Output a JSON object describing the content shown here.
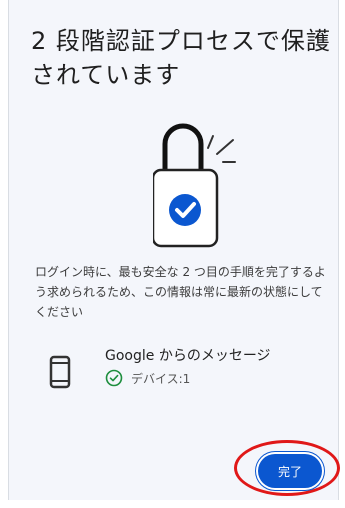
{
  "dialog": {
    "title": "2 段階認証プロセスで保護されています",
    "description": "ログイン時に、最も安全な 2 つ目の手順を完了するよう求められるため、この情報は常に最新の状態にしてください"
  },
  "device": {
    "title": "Google からのメッセージ",
    "count_text": "デバイス:1",
    "icons": {
      "device": "phone-icon",
      "status": "check-circle-icon"
    }
  },
  "actions": {
    "done_label": "完了"
  },
  "illustration": {
    "icon": "lock-with-check-icon"
  },
  "colors": {
    "accent": "#0b57d0",
    "highlight": "#e01818",
    "check": "#1e8e3e"
  }
}
